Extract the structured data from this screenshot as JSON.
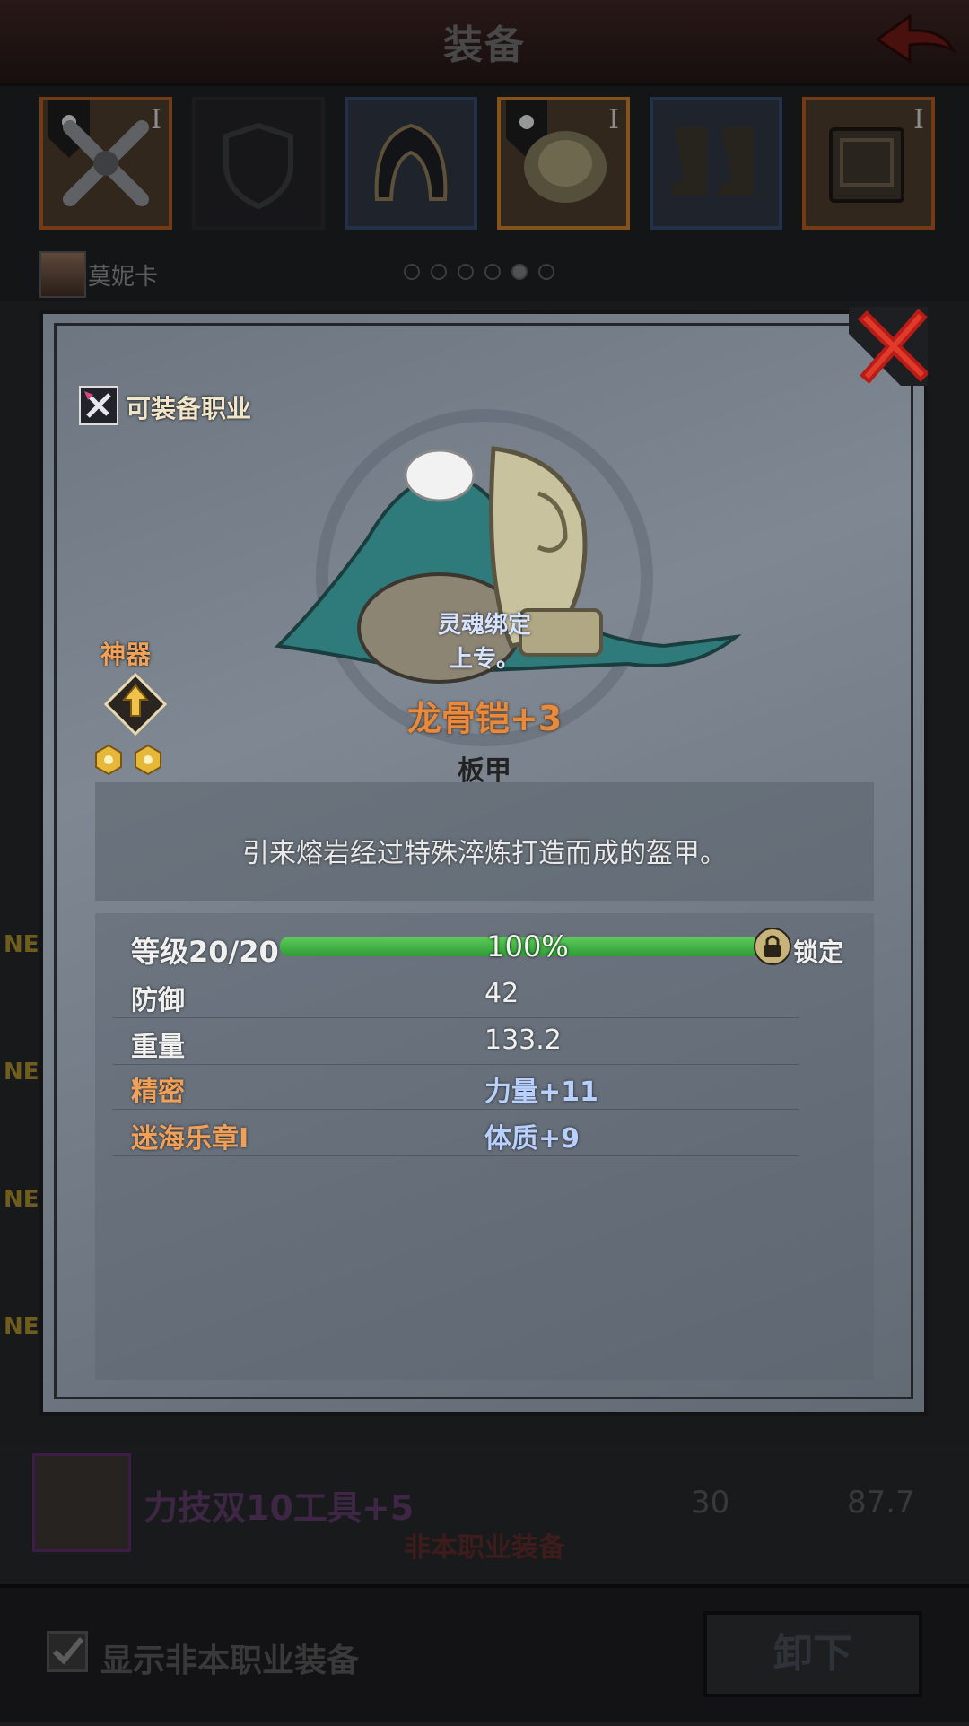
{
  "header": {
    "title": "装备",
    "back_icon": "back-arrow-icon"
  },
  "slots": [
    {
      "name": "weapon",
      "tier": "I",
      "rarity": "orange"
    },
    {
      "name": "shield",
      "tier": "",
      "rarity": "empty"
    },
    {
      "name": "helmet",
      "tier": "",
      "rarity": "blue"
    },
    {
      "name": "armor",
      "tier": "I",
      "rarity": "orange",
      "selected": true
    },
    {
      "name": "boots",
      "tier": "",
      "rarity": "blue"
    },
    {
      "name": "book",
      "tier": "I",
      "rarity": "orange"
    }
  ],
  "character": {
    "name": "莫妮卡",
    "page_dots": 6,
    "active_dot": 5
  },
  "background_list": {
    "new_tag": "NEW",
    "item_name": "力技双10工具+5",
    "value1": "30",
    "value2": "87.7",
    "subtitle": "非本职业装备"
  },
  "bottom": {
    "checkbox_label": "显示非本职业装备",
    "checkbox_checked": true,
    "unequip_label": "卸下"
  },
  "modal": {
    "class_label": "可装备职业",
    "artifact_label": "神器",
    "soulbound_line1": "灵魂绑定",
    "soulbound_line2": "上专。",
    "item_name": "龙骨铠+3",
    "item_type": "板甲",
    "description": "引来熔岩经过特殊淬炼打造而成的盔甲。",
    "level": {
      "label": "等级20/20",
      "percent_text": "100%",
      "percent": 100,
      "lock_label": "锁定"
    },
    "stats": [
      {
        "label": "防御",
        "value": "42"
      },
      {
        "label": "重量",
        "value": "133.2"
      },
      {
        "label": "精密",
        "value": "力量+11"
      },
      {
        "label": "迷海乐章I",
        "value": "体质+9"
      }
    ]
  }
}
